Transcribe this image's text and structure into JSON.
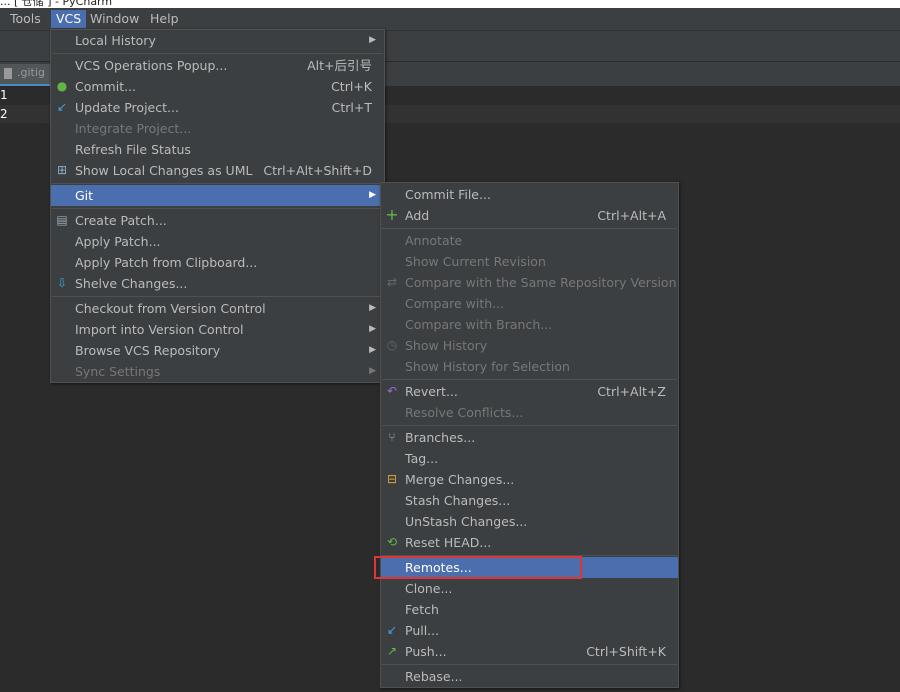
{
  "window": {
    "title": "... [ 仓储 ] - PyCharm"
  },
  "menubar": {
    "items": [
      "Tools",
      "VCS",
      "Window",
      "Help"
    ]
  },
  "editor": {
    "tab_label": ".gitig",
    "line_numbers": [
      "1",
      "2"
    ]
  },
  "vcs_menu": {
    "local_history": "Local History",
    "vcs_operations_popup": "VCS Operations Popup...",
    "vcs_operations_popup_shortcut": "Alt+后引号",
    "commit": "Commit...",
    "commit_shortcut": "Ctrl+K",
    "update_project": "Update Project...",
    "update_project_shortcut": "Ctrl+T",
    "integrate_project": "Integrate Project...",
    "refresh_file_status": "Refresh File Status",
    "show_local_changes_uml": "Show Local Changes as UML",
    "show_local_changes_uml_shortcut": "Ctrl+Alt+Shift+D",
    "git": "Git",
    "create_patch": "Create Patch...",
    "apply_patch": "Apply Patch...",
    "apply_patch_clipboard": "Apply Patch from Clipboard...",
    "shelve_changes": "Shelve Changes...",
    "checkout": "Checkout from Version Control",
    "import": "Import into Version Control",
    "browse_repo": "Browse VCS Repository",
    "sync_settings": "Sync Settings"
  },
  "git_menu": {
    "commit_file": "Commit File...",
    "add": "Add",
    "add_shortcut": "Ctrl+Alt+A",
    "annotate": "Annotate",
    "show_current_revision": "Show Current Revision",
    "compare_same_repo": "Compare with the Same Repository Version",
    "compare_with": "Compare with...",
    "compare_with_branch": "Compare with Branch...",
    "show_history": "Show History",
    "show_history_selection": "Show History for Selection",
    "revert": "Revert...",
    "revert_shortcut": "Ctrl+Alt+Z",
    "resolve_conflicts": "Resolve Conflicts...",
    "branches": "Branches...",
    "tag": "Tag...",
    "merge_changes": "Merge Changes...",
    "stash_changes": "Stash Changes...",
    "unstash_changes": "UnStash Changes...",
    "reset_head": "Reset HEAD...",
    "remotes": "Remotes...",
    "clone": "Clone...",
    "fetch": "Fetch",
    "pull": "Pull...",
    "push": "Push...",
    "push_shortcut": "Ctrl+Shift+K",
    "rebase": "Rebase..."
  },
  "colors": {
    "menu_bg": "#3c3f41",
    "selection": "#4b6eaf",
    "highlight_box": "#e03535"
  }
}
